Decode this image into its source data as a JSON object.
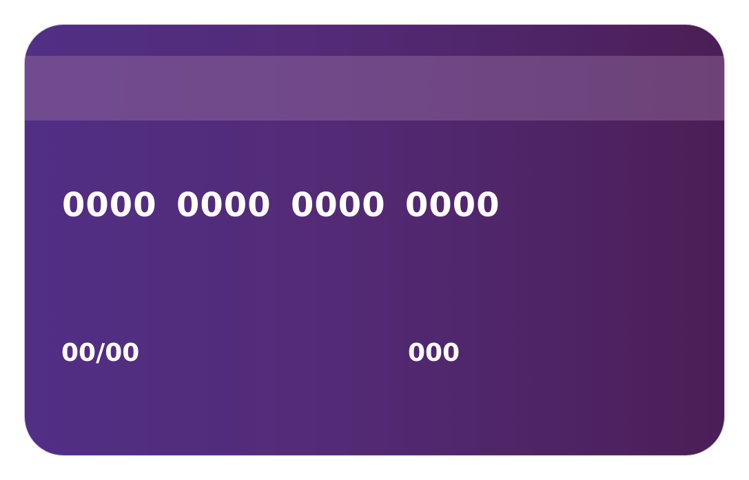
{
  "card": {
    "number_groups": [
      "0000",
      "0000",
      "0000",
      "0000"
    ],
    "expiry": "00/00",
    "cvv": "000"
  },
  "colors": {
    "gradient_start": "#512f85",
    "gradient_end": "#4c1e56",
    "stripe": "#6a4b80",
    "text": "#ffffff"
  }
}
